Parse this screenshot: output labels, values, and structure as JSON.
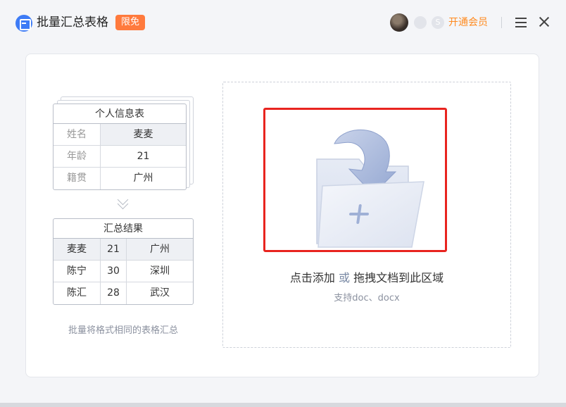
{
  "app": {
    "title": "批量汇总表格",
    "badge": "限免",
    "vip_link": "开通会员",
    "coin_symbol": "S"
  },
  "icons": {
    "logo": "app-logo-icon",
    "avatar": "user-avatar",
    "badge1": "membership-badge-icon",
    "badge2": "coin-badge-icon",
    "menu": "hamburger-menu-icon",
    "close": "close-icon",
    "arrow": "double-chevron-down-icon",
    "folder": "upload-folder-icon"
  },
  "colors": {
    "accent": "#3d7bf6",
    "badge": "#ff7a3d",
    "vip": "#ff8a1f",
    "highlight_frame": "#e8241f"
  },
  "example_table": {
    "title": "个人信息表",
    "rows": [
      {
        "label": "姓名",
        "value": "麦麦"
      },
      {
        "label": "年龄",
        "value": "21"
      },
      {
        "label": "籍贯",
        "value": "广州"
      }
    ]
  },
  "result_table": {
    "title": "汇总结果",
    "rows": [
      [
        "麦麦",
        "21",
        "广州"
      ],
      [
        "陈宁",
        "30",
        "深圳"
      ],
      [
        "陈汇",
        "28",
        "武汉"
      ]
    ]
  },
  "caption": "批量将格式相同的表格汇总",
  "dropzone": {
    "click_add": "点击添加",
    "or": "或",
    "drag_text": "拖拽文档到此区域",
    "support": "支持doc、docx"
  }
}
